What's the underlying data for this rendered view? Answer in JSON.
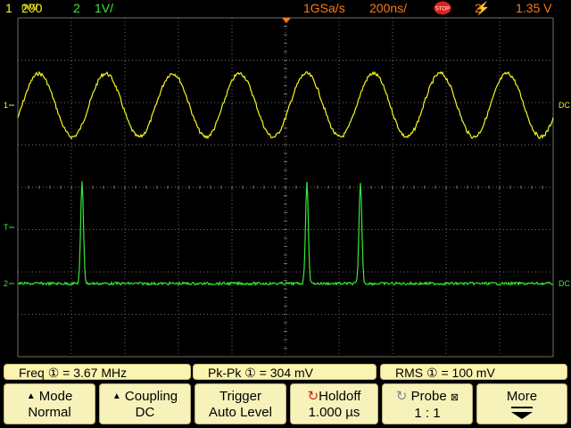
{
  "status": {
    "ch1_num": "1",
    "ch1_scale": "200",
    "ch1_unit": "mV/",
    "ch2_num": "2",
    "ch2_scale": "1V/",
    "sample_rate": "1GSa/s",
    "timebase": "200ns/",
    "trigger_channel": "2",
    "trigger_level": "1.35 V"
  },
  "markers": {
    "ch1": "1",
    "ch2": "2",
    "trigger": "T",
    "ch1_right": "DC",
    "ch2_right": "DC"
  },
  "measurements": [
    {
      "label": "Freq",
      "value": "= 3.67 MHz"
    },
    {
      "label": "Pk-Pk",
      "value": "= 304 mV"
    },
    {
      "label": "RMS",
      "value": "= 100 mV"
    }
  ],
  "softkeys": [
    {
      "top": "Mode",
      "bottom": "Normal"
    },
    {
      "top": "Coupling",
      "bottom": "DC"
    },
    {
      "top": "Trigger",
      "bottom": "Auto Level"
    },
    {
      "top": "Holdoff",
      "bottom": "1.000 µs"
    },
    {
      "top": "Probe",
      "bottom": "1 : 1"
    },
    {
      "top": "More",
      "bottom": ""
    }
  ],
  "colors": {
    "ch1": "#f5f520",
    "ch2": "#38e838",
    "trigger": "#ff7a14",
    "grid": "#6e6e6e",
    "softkey_bg": "#f7f2ba"
  },
  "waveforms": {
    "ch1": {
      "type": "sine",
      "cycles": 8,
      "vertical_divisions_pp": 1.5
    },
    "ch2": {
      "type": "pulses",
      "pulse_times_div": [
        1.2,
        5.4,
        6.4
      ],
      "pulse_height_div": 2.4
    }
  }
}
